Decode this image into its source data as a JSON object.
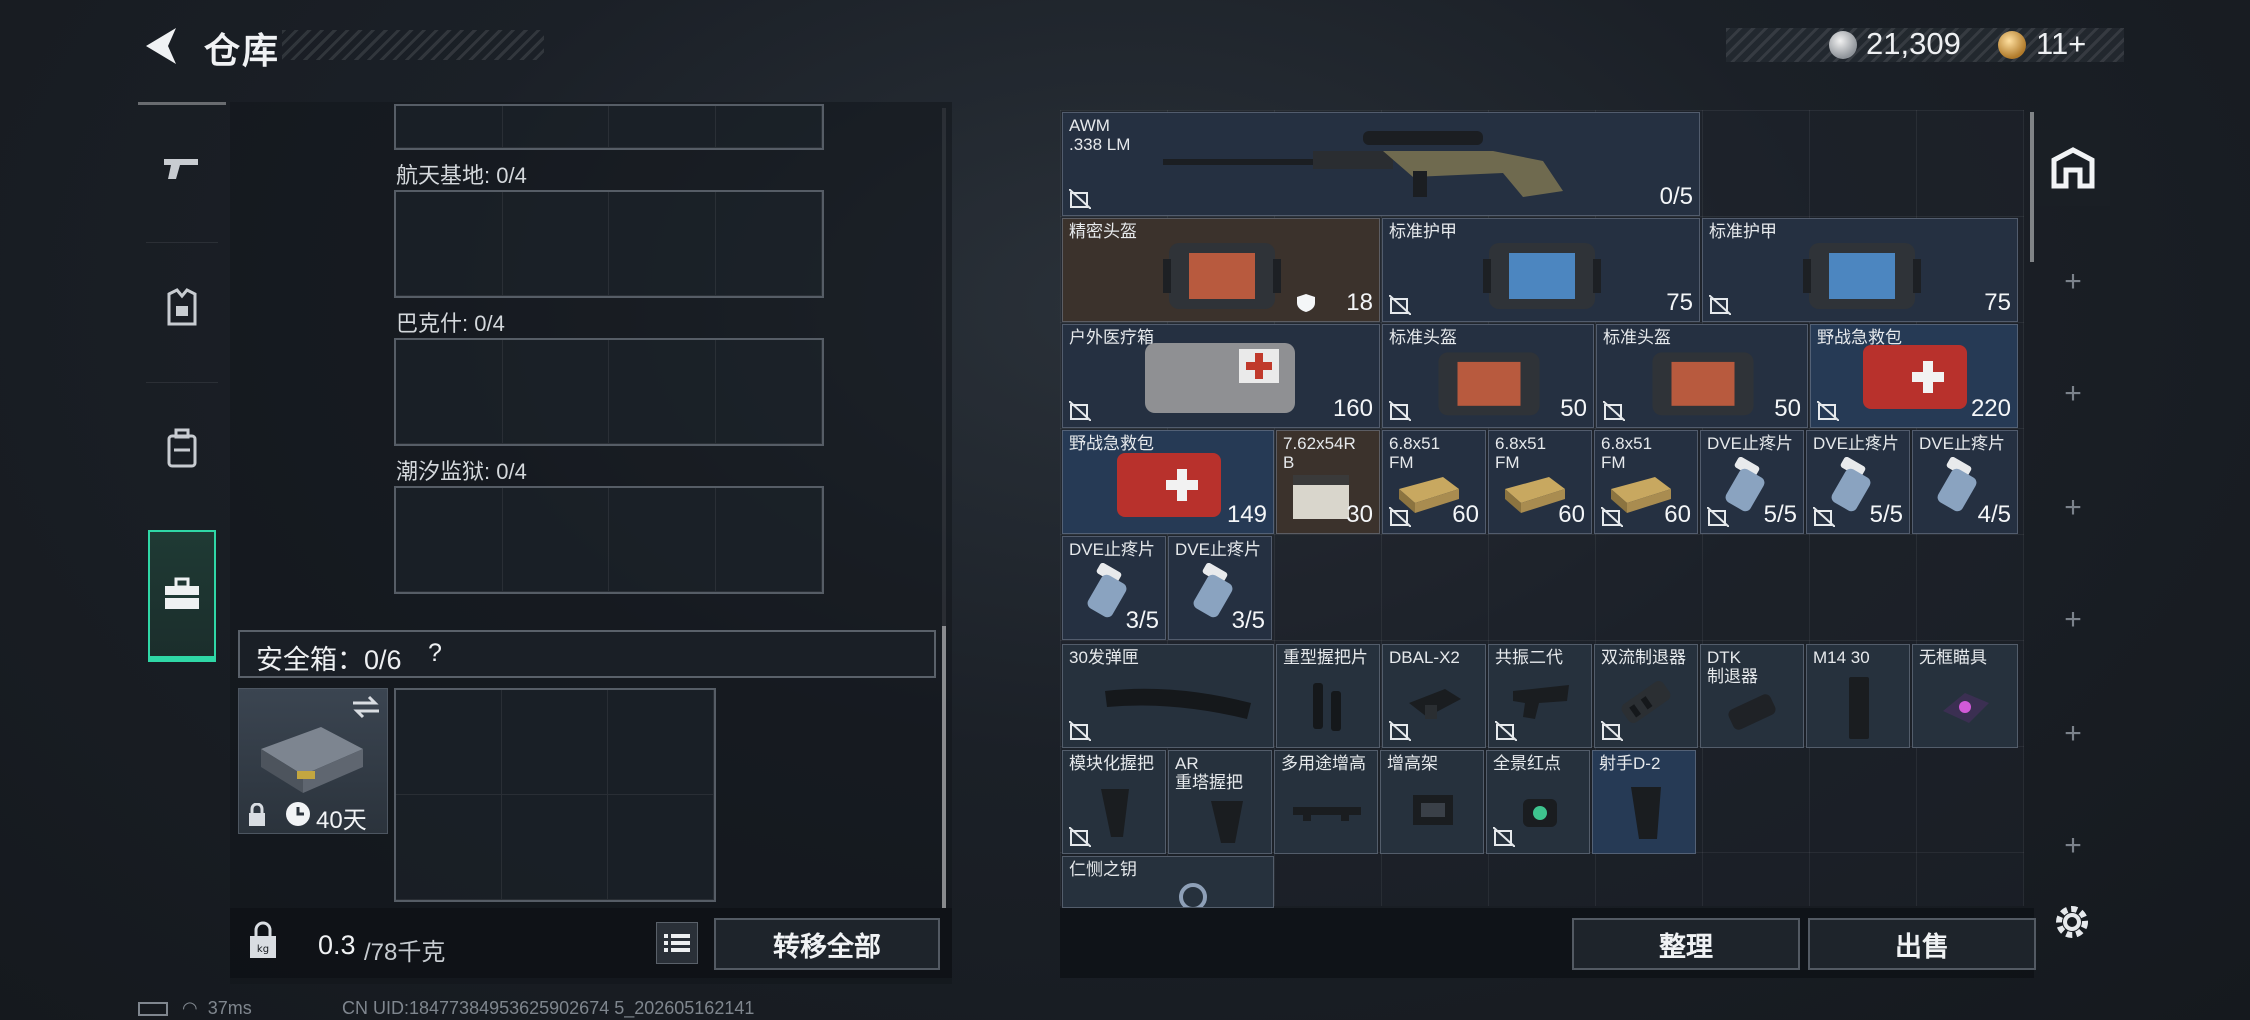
{
  "header": {
    "title": "仓库",
    "money": "21,309",
    "tokens": "11+"
  },
  "left": {
    "maps": [
      {
        "label": "航天基地: 0/4"
      },
      {
        "label": "巴克什: 0/4"
      },
      {
        "label": "潮汐监狱: 0/4"
      }
    ],
    "safebox_label": "安全箱：0/6",
    "safebox_help": "?",
    "safebox_days": "40天",
    "weight_value": "0.3",
    "weight_unit": "/78千克",
    "transfer_label": "转移全部"
  },
  "stash": {
    "items": [
      {
        "name": "AWM\n.338 LM",
        "qty": "0/5"
      },
      {
        "name": "精密头盔",
        "qty": "18"
      },
      {
        "name": "标准护甲",
        "qty": "75"
      },
      {
        "name": "标准护甲",
        "qty": "75"
      },
      {
        "name": "户外医疗箱",
        "qty": "160"
      },
      {
        "name": "标准头盔",
        "qty": "50"
      },
      {
        "name": "标准头盔",
        "qty": "50"
      },
      {
        "name": "野战急救包",
        "qty": "220"
      },
      {
        "name": "野战急救包",
        "qty": "149"
      },
      {
        "name": "7.62x54R\nB",
        "qty": "30"
      },
      {
        "name": "6.8x51\nFM",
        "qty": "60"
      },
      {
        "name": "6.8x51\nFM",
        "qty": "60"
      },
      {
        "name": "6.8x51\nFM",
        "qty": "60"
      },
      {
        "name": "DVE止疼片",
        "qty": "5/5"
      },
      {
        "name": "DVE止疼片",
        "qty": "5/5"
      },
      {
        "name": "DVE止疼片",
        "qty": "4/5"
      },
      {
        "name": "DVE止疼片",
        "qty": "3/5"
      },
      {
        "name": "DVE止疼片",
        "qty": "3/5"
      },
      {
        "name": "30发弹匣",
        "qty": ""
      },
      {
        "name": "重型握把片",
        "qty": ""
      },
      {
        "name": "DBAL-X2",
        "qty": ""
      },
      {
        "name": "共振二代",
        "qty": ""
      },
      {
        "name": "双流制退器",
        "qty": ""
      },
      {
        "name": "DTK\n制退器",
        "qty": ""
      },
      {
        "name": "M14 30",
        "qty": ""
      },
      {
        "name": "无框瞄具",
        "qty": ""
      },
      {
        "name": "模块化握把",
        "qty": ""
      },
      {
        "name": "AR\n重塔握把",
        "qty": ""
      },
      {
        "name": "多用途增高",
        "qty": ""
      },
      {
        "name": "增高架",
        "qty": ""
      },
      {
        "name": "全景红点",
        "qty": ""
      },
      {
        "name": "射手D-2",
        "qty": ""
      },
      {
        "name": "仁恻之钥",
        "qty": ""
      }
    ],
    "sort_label": "整理",
    "sell_label": "出售"
  },
  "status": {
    "ping": "37ms",
    "uid": "CN UID:18477384953625902674 5_202605162141"
  },
  "colors": {
    "accent": "#2fd7a6",
    "rarity_brown": "#3b322c",
    "rarity_blue": "#263a55"
  }
}
